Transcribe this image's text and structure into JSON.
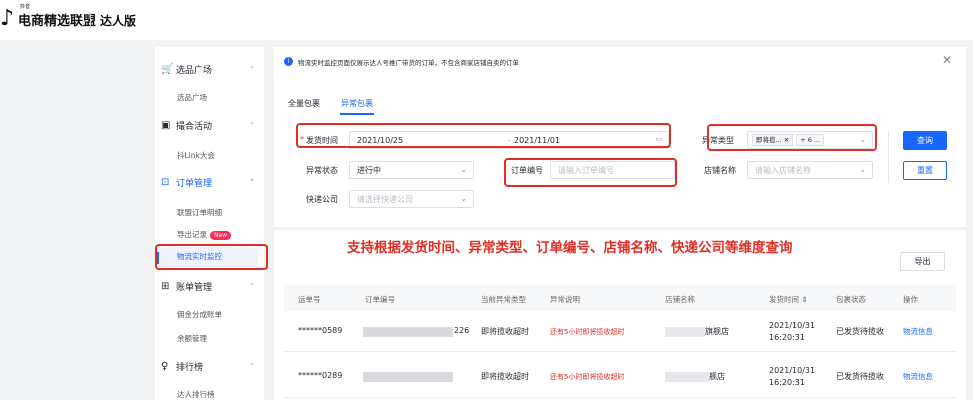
{
  "header": {
    "logo_glyph": "♪",
    "brand_small": "抖音",
    "brand": "电商精选联盟",
    "sub": "达人版"
  },
  "sidebar": {
    "groups": [
      {
        "icon": "🛒",
        "icon_name": "cart-icon",
        "label": "选品广场",
        "items": [
          "选品广场"
        ]
      },
      {
        "icon": "▣",
        "icon_name": "activity-icon",
        "label": "撮合活动",
        "items": [
          "抖Link大会"
        ]
      },
      {
        "icon": "⊡",
        "icon_name": "order-icon",
        "label": "订单管理",
        "items": [
          "联盟订单明细",
          "导出记录",
          "物流实时监控"
        ],
        "badge": "New"
      },
      {
        "icon": "⊞",
        "icon_name": "bill-icon",
        "label": "账单管理",
        "items": [
          "佣金分成账单",
          "余额管理"
        ]
      },
      {
        "icon": "♀",
        "icon_name": "ranking-icon",
        "label": "排行榜",
        "items": [
          "达人排行榜"
        ]
      }
    ],
    "chevron": "⌃"
  },
  "notice": {
    "icon": "i",
    "text": "物流实时监控页面仅展示达人号推广带货的订单，不包含商家店铺自卖的订单",
    "close": "✕"
  },
  "tabs": [
    {
      "label": "全量包裹",
      "active": false
    },
    {
      "label": "异常包裹",
      "active": true
    }
  ],
  "filters": {
    "ship_time": {
      "label": "发货时间",
      "required_mark": "*",
      "start": "2021/10/25",
      "sep": "-",
      "end": "2021/11/01",
      "icon": "▭"
    },
    "exception_type": {
      "label": "异常类型",
      "tag1": "即将揽... ✕",
      "tag2": "+ 6 ...",
      "chevron": "⌄"
    },
    "exception_status": {
      "label": "异常状态",
      "value": "进行中",
      "chevron": "⌄"
    },
    "order_no": {
      "label": "订单编号",
      "placeholder": "请输入订单编号"
    },
    "shop_name": {
      "label": "店铺名称",
      "placeholder": "请输入店铺名称",
      "chevron": "⌄"
    },
    "courier": {
      "label": "快递公司",
      "placeholder": "请选择快递公司",
      "chevron": "⌄"
    }
  },
  "buttons": {
    "query": "查询",
    "reset": "重置",
    "export": "导出"
  },
  "annotation": "支持根据发货时间、异常类型、订单编号、店铺名称、快递公司等维度查询",
  "table": {
    "columns": [
      "运单号",
      "订单编号",
      "当前异常类型",
      "异常说明",
      "店铺名称",
      "发货时间 ⇕",
      "包裹状态",
      "操作"
    ],
    "rows": [
      {
        "waybill": "******0589",
        "order_suffix": "226",
        "type": "即将揽收超时",
        "desc": "还有5小时即将揽收超时",
        "shop_suffix": "旗舰店",
        "time_date": "2021/10/31",
        "time_clock": "16:20:31",
        "status": "已发货待揽收",
        "action": "物流信息"
      },
      {
        "waybill": "******0289",
        "order_suffix": "",
        "type": "即将揽收超时",
        "desc": "还有5小时即将揽收超时",
        "shop_suffix": "舰店",
        "time_date": "2021/10/31",
        "time_clock": "16:20:31",
        "status": "已发货待揽收",
        "action": "物流信息"
      }
    ]
  },
  "colors": {
    "accent": "#1966ff",
    "annotation_red": "#e02e24",
    "badge": "#fe2c55"
  }
}
